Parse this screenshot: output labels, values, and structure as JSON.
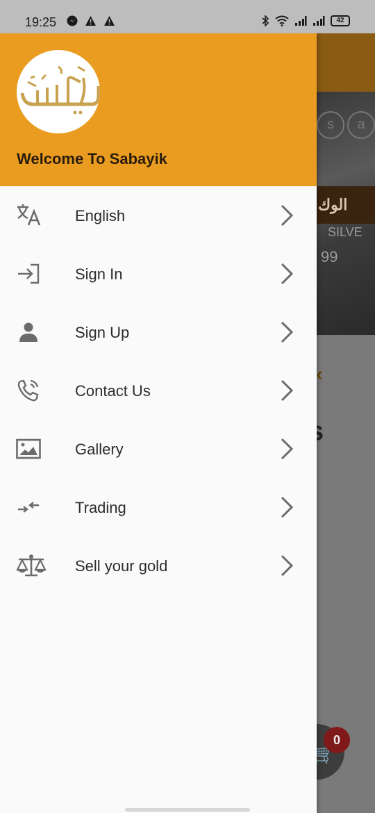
{
  "status_bar": {
    "time": "19:25",
    "battery": "42",
    "left_icons": [
      "messenger-icon",
      "warning-icon",
      "warning-icon"
    ],
    "right_icons": [
      "bluetooth-icon",
      "wifi-icon",
      "signal-icon",
      "signal-icon",
      "battery-icon"
    ]
  },
  "drawer": {
    "logo_text": "سبائك",
    "welcome": "Welcome To Sabayik",
    "header_color": "#ea9c20",
    "items": [
      {
        "label": "English",
        "icon": "translate-icon"
      },
      {
        "label": "Sign In",
        "icon": "login-icon"
      },
      {
        "label": "Sign Up",
        "icon": "person-icon"
      },
      {
        "label": "Contact Us",
        "icon": "phone-call-icon"
      },
      {
        "label": "Gallery",
        "icon": "gallery-icon"
      },
      {
        "label": "Trading",
        "icon": "compare-arrows-icon"
      },
      {
        "label": "Sell your gold",
        "icon": "balance-scale-icon"
      }
    ]
  },
  "background": {
    "banner_arabic": "الوك",
    "bar_text": "SILVE",
    "purity": "99",
    "coin_letters": [
      "s",
      "a"
    ],
    "partial_letter": "s",
    "cart_badge": "0"
  }
}
